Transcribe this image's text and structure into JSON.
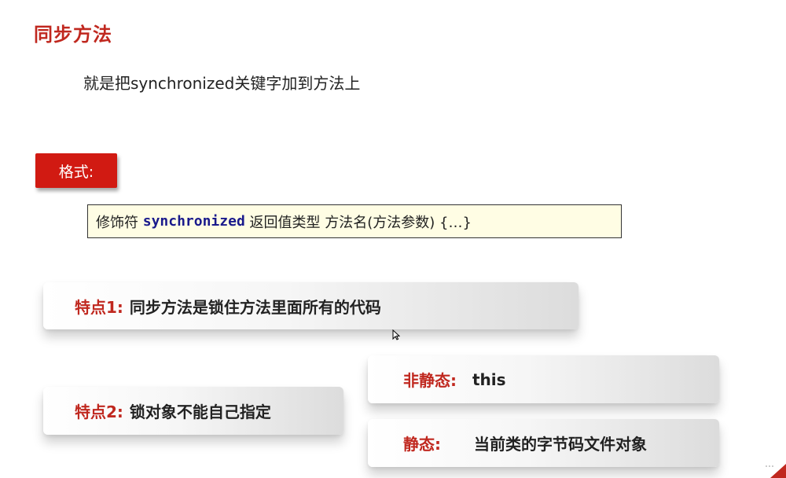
{
  "title": "同步方法",
  "subtitle": "就是把synchronized关键字加到方法上",
  "format_badge": "格式:",
  "code": {
    "before": "修饰符 ",
    "keyword": "synchronized",
    "after": " 返回值类型 方法名(方法参数) {…}"
  },
  "feature1": {
    "label": "特点1:",
    "text": "同步方法是锁住方法里面所有的代码"
  },
  "feature2": {
    "label": "特点2:",
    "text": "锁对象不能自己指定"
  },
  "non_static": {
    "label": "非静态:",
    "value": "this"
  },
  "static": {
    "label": "静态:",
    "value": "当前类的字节码文件对象"
  },
  "colors": {
    "accent_red": "#c0281f",
    "badge_red": "#d11a12",
    "code_bg": "#fffde4",
    "keyword_blue": "#1a1a8c"
  },
  "icons": [
    "mouse-cursor-icon"
  ]
}
